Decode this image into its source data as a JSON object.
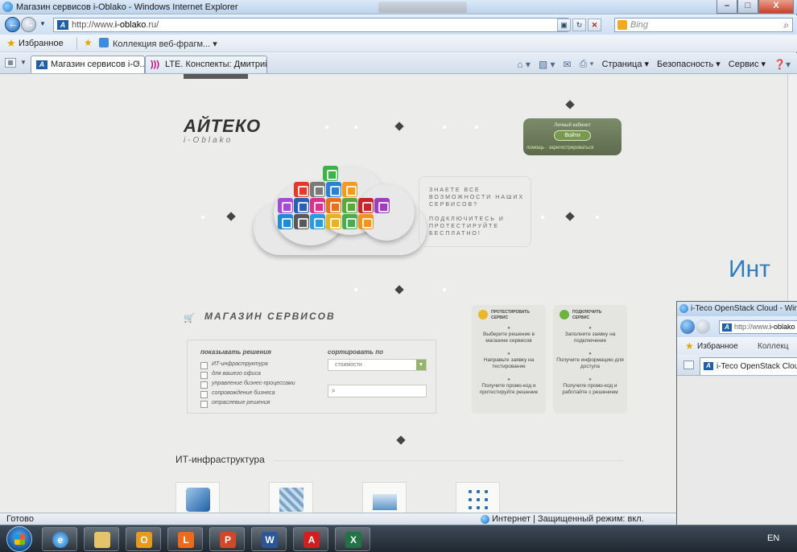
{
  "window": {
    "title": "Магазин сервисов i-Oblako - Windows Internet Explorer",
    "min_glyph": "–",
    "max_glyph": "□",
    "close_glyph": "X"
  },
  "address": {
    "url_prefix": "http://www.",
    "url_domain": "i-oblako",
    "url_suffix": ".ru/",
    "search_placeholder": "Bing"
  },
  "favorites_bar": {
    "favorites_label": "Избранное",
    "webslices_label": "Коллекция веб-фрагм... ▾"
  },
  "tabs": [
    {
      "label": "Магазин сервисов i-O...",
      "close": "X"
    },
    {
      "label": "LTE. Конспекты: Дмитрий..."
    }
  ],
  "command_bar": {
    "page": "Страница ▾",
    "safety": "Безопасность ▾",
    "tools": "Сервис ▾"
  },
  "site": {
    "logo": "АЙТЕКО",
    "logo_sub": "i-Oblako",
    "cabinet": {
      "title": "Личный кабинет",
      "login": "Войти",
      "help": "помощь",
      "register": "зарегистрироваться"
    },
    "promo_1": "ЗНАЕТЕ ВСЕ ВОЗМОЖНОСТИ НАШИХ СЕРВИСОВ?",
    "promo_2": "ПОДКЛЮЧИТЕСЬ И ПРОТЕСТИРУЙТЕ БЕСПЛАТНО!",
    "shop_title": "МАГАЗИН СЕРВИСОВ",
    "filters": {
      "show_heading": "показывать решения",
      "items": [
        "ИТ-инфраструктура",
        "для вашего офиса",
        "управление бизнес-процессами",
        "сопровождение бизнеса",
        "отраслевые решения"
      ],
      "sort_heading": "сортировать по",
      "sort_value": "стоимости",
      "search_icon": "🔍"
    },
    "test_box": {
      "heading_1": "ПРОТЕСТИРОВАТЬ",
      "heading_2": "СЕРВИС",
      "steps": [
        "Выберите решение в магазине сервисов",
        "Направьте заявку на тестирование",
        "Получите промо-код и протестируйте решение"
      ]
    },
    "connect_box": {
      "heading_1": "ПОДКЛЮЧИТЬ",
      "heading_2": "СЕРВИС",
      "steps": [
        "Заполните заявку на подключение",
        "Получите информацию для доступа",
        "Получите промо-код и работайте с решением"
      ]
    },
    "section_title": "ИТ-инфраструктура"
  },
  "background_heading": "Инт",
  "status": {
    "text": "Готово",
    "zone": "Интернет | Защищенный режим: вкл."
  },
  "window2": {
    "title": "i-Teco OpenStack Cloud - Windows I",
    "url_prefix": "http://www.",
    "url_domain": "i-oblako",
    "favorites_label": "Избранное",
    "webslices_label": "Коллекц",
    "tab_label": "i-Teco OpenStack Cloud",
    "tab_close": "X"
  },
  "taskbar": {
    "language": "EN",
    "apps": [
      "internet-explorer",
      "file-explorer",
      "outlook",
      "lync",
      "powerpoint",
      "word",
      "acrobat",
      "excel"
    ]
  },
  "colors": {
    "accent_green": "#97b56a",
    "heading_blue": "#2f7cc2",
    "test_badge": "#e8b72a",
    "connect_badge": "#6cb33f"
  }
}
